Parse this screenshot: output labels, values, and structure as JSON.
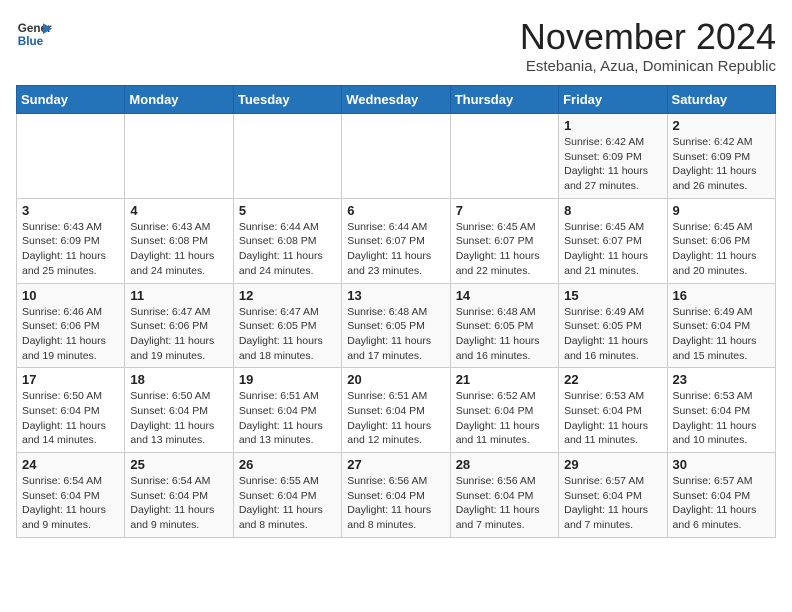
{
  "header": {
    "logo_line1": "General",
    "logo_line2": "Blue",
    "month": "November 2024",
    "location": "Estebania, Azua, Dominican Republic"
  },
  "weekdays": [
    "Sunday",
    "Monday",
    "Tuesday",
    "Wednesday",
    "Thursday",
    "Friday",
    "Saturday"
  ],
  "weeks": [
    [
      {
        "day": "",
        "info": ""
      },
      {
        "day": "",
        "info": ""
      },
      {
        "day": "",
        "info": ""
      },
      {
        "day": "",
        "info": ""
      },
      {
        "day": "",
        "info": ""
      },
      {
        "day": "1",
        "info": "Sunrise: 6:42 AM\nSunset: 6:09 PM\nDaylight: 11 hours and 27 minutes."
      },
      {
        "day": "2",
        "info": "Sunrise: 6:42 AM\nSunset: 6:09 PM\nDaylight: 11 hours and 26 minutes."
      }
    ],
    [
      {
        "day": "3",
        "info": "Sunrise: 6:43 AM\nSunset: 6:09 PM\nDaylight: 11 hours and 25 minutes."
      },
      {
        "day": "4",
        "info": "Sunrise: 6:43 AM\nSunset: 6:08 PM\nDaylight: 11 hours and 24 minutes."
      },
      {
        "day": "5",
        "info": "Sunrise: 6:44 AM\nSunset: 6:08 PM\nDaylight: 11 hours and 24 minutes."
      },
      {
        "day": "6",
        "info": "Sunrise: 6:44 AM\nSunset: 6:07 PM\nDaylight: 11 hours and 23 minutes."
      },
      {
        "day": "7",
        "info": "Sunrise: 6:45 AM\nSunset: 6:07 PM\nDaylight: 11 hours and 22 minutes."
      },
      {
        "day": "8",
        "info": "Sunrise: 6:45 AM\nSunset: 6:07 PM\nDaylight: 11 hours and 21 minutes."
      },
      {
        "day": "9",
        "info": "Sunrise: 6:45 AM\nSunset: 6:06 PM\nDaylight: 11 hours and 20 minutes."
      }
    ],
    [
      {
        "day": "10",
        "info": "Sunrise: 6:46 AM\nSunset: 6:06 PM\nDaylight: 11 hours and 19 minutes."
      },
      {
        "day": "11",
        "info": "Sunrise: 6:47 AM\nSunset: 6:06 PM\nDaylight: 11 hours and 19 minutes."
      },
      {
        "day": "12",
        "info": "Sunrise: 6:47 AM\nSunset: 6:05 PM\nDaylight: 11 hours and 18 minutes."
      },
      {
        "day": "13",
        "info": "Sunrise: 6:48 AM\nSunset: 6:05 PM\nDaylight: 11 hours and 17 minutes."
      },
      {
        "day": "14",
        "info": "Sunrise: 6:48 AM\nSunset: 6:05 PM\nDaylight: 11 hours and 16 minutes."
      },
      {
        "day": "15",
        "info": "Sunrise: 6:49 AM\nSunset: 6:05 PM\nDaylight: 11 hours and 16 minutes."
      },
      {
        "day": "16",
        "info": "Sunrise: 6:49 AM\nSunset: 6:04 PM\nDaylight: 11 hours and 15 minutes."
      }
    ],
    [
      {
        "day": "17",
        "info": "Sunrise: 6:50 AM\nSunset: 6:04 PM\nDaylight: 11 hours and 14 minutes."
      },
      {
        "day": "18",
        "info": "Sunrise: 6:50 AM\nSunset: 6:04 PM\nDaylight: 11 hours and 13 minutes."
      },
      {
        "day": "19",
        "info": "Sunrise: 6:51 AM\nSunset: 6:04 PM\nDaylight: 11 hours and 13 minutes."
      },
      {
        "day": "20",
        "info": "Sunrise: 6:51 AM\nSunset: 6:04 PM\nDaylight: 11 hours and 12 minutes."
      },
      {
        "day": "21",
        "info": "Sunrise: 6:52 AM\nSunset: 6:04 PM\nDaylight: 11 hours and 11 minutes."
      },
      {
        "day": "22",
        "info": "Sunrise: 6:53 AM\nSunset: 6:04 PM\nDaylight: 11 hours and 11 minutes."
      },
      {
        "day": "23",
        "info": "Sunrise: 6:53 AM\nSunset: 6:04 PM\nDaylight: 11 hours and 10 minutes."
      }
    ],
    [
      {
        "day": "24",
        "info": "Sunrise: 6:54 AM\nSunset: 6:04 PM\nDaylight: 11 hours and 9 minutes."
      },
      {
        "day": "25",
        "info": "Sunrise: 6:54 AM\nSunset: 6:04 PM\nDaylight: 11 hours and 9 minutes."
      },
      {
        "day": "26",
        "info": "Sunrise: 6:55 AM\nSunset: 6:04 PM\nDaylight: 11 hours and 8 minutes."
      },
      {
        "day": "27",
        "info": "Sunrise: 6:56 AM\nSunset: 6:04 PM\nDaylight: 11 hours and 8 minutes."
      },
      {
        "day": "28",
        "info": "Sunrise: 6:56 AM\nSunset: 6:04 PM\nDaylight: 11 hours and 7 minutes."
      },
      {
        "day": "29",
        "info": "Sunrise: 6:57 AM\nSunset: 6:04 PM\nDaylight: 11 hours and 7 minutes."
      },
      {
        "day": "30",
        "info": "Sunrise: 6:57 AM\nSunset: 6:04 PM\nDaylight: 11 hours and 6 minutes."
      }
    ]
  ]
}
